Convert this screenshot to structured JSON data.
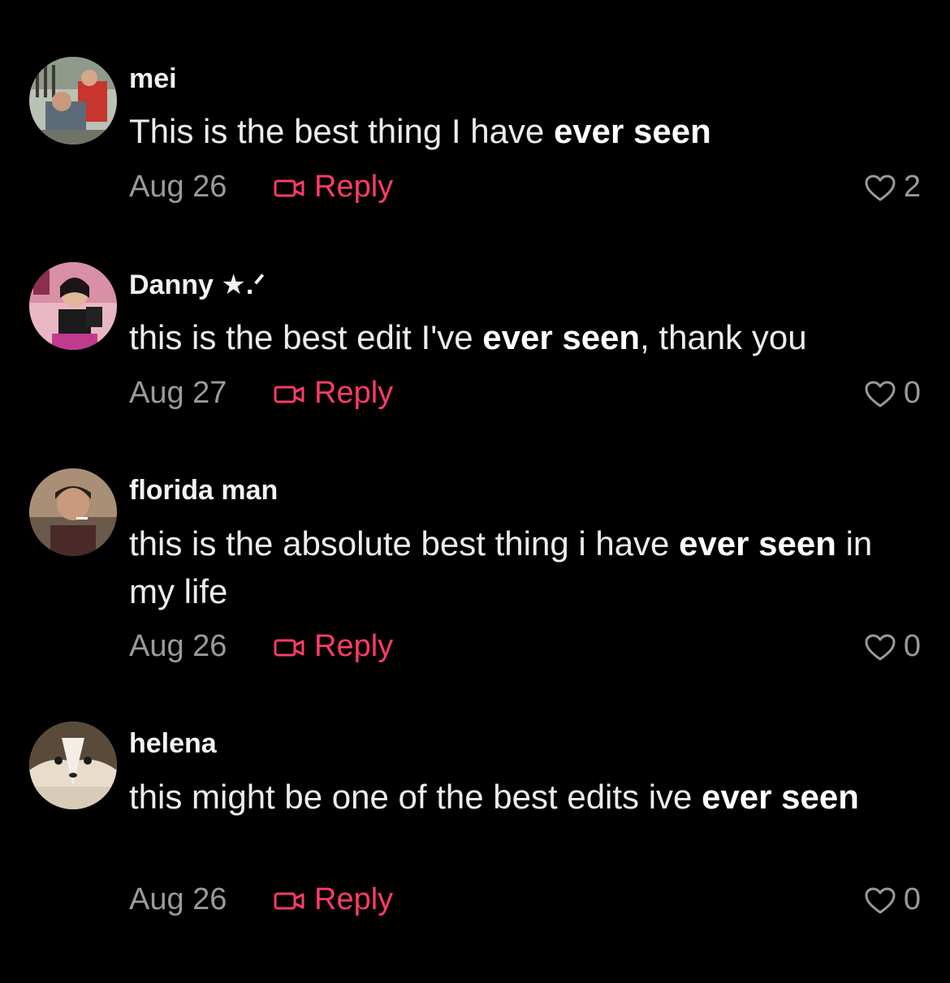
{
  "comments": [
    {
      "username": "mei",
      "text_parts": [
        "This is the best thing I have ",
        "ever seen",
        ""
      ],
      "date": "Aug 26",
      "reply_label": "Reply",
      "likes": "2"
    },
    {
      "username": "Danny ★.ᐟ",
      "text_parts": [
        "this is the best edit I've ",
        "ever seen",
        ", thank you"
      ],
      "date": "Aug 27",
      "reply_label": "Reply",
      "likes": "0"
    },
    {
      "username": "florida man",
      "text_parts": [
        "this is the absolute best thing i have ",
        "ever seen",
        " in my life"
      ],
      "date": "Aug 26",
      "reply_label": "Reply",
      "likes": "0"
    },
    {
      "username": "helena",
      "text_parts": [
        "this might be one of the best edits ive ",
        "ever seen",
        ""
      ],
      "date": "Aug 26",
      "reply_label": "Reply",
      "likes": "0"
    }
  ],
  "colors": {
    "background": "#000000",
    "reply_accent": "#fe3c66",
    "secondary_text": "#9a9a9a"
  },
  "icons": {
    "reply": "video-reply-icon",
    "like": "heart-outline-icon"
  }
}
